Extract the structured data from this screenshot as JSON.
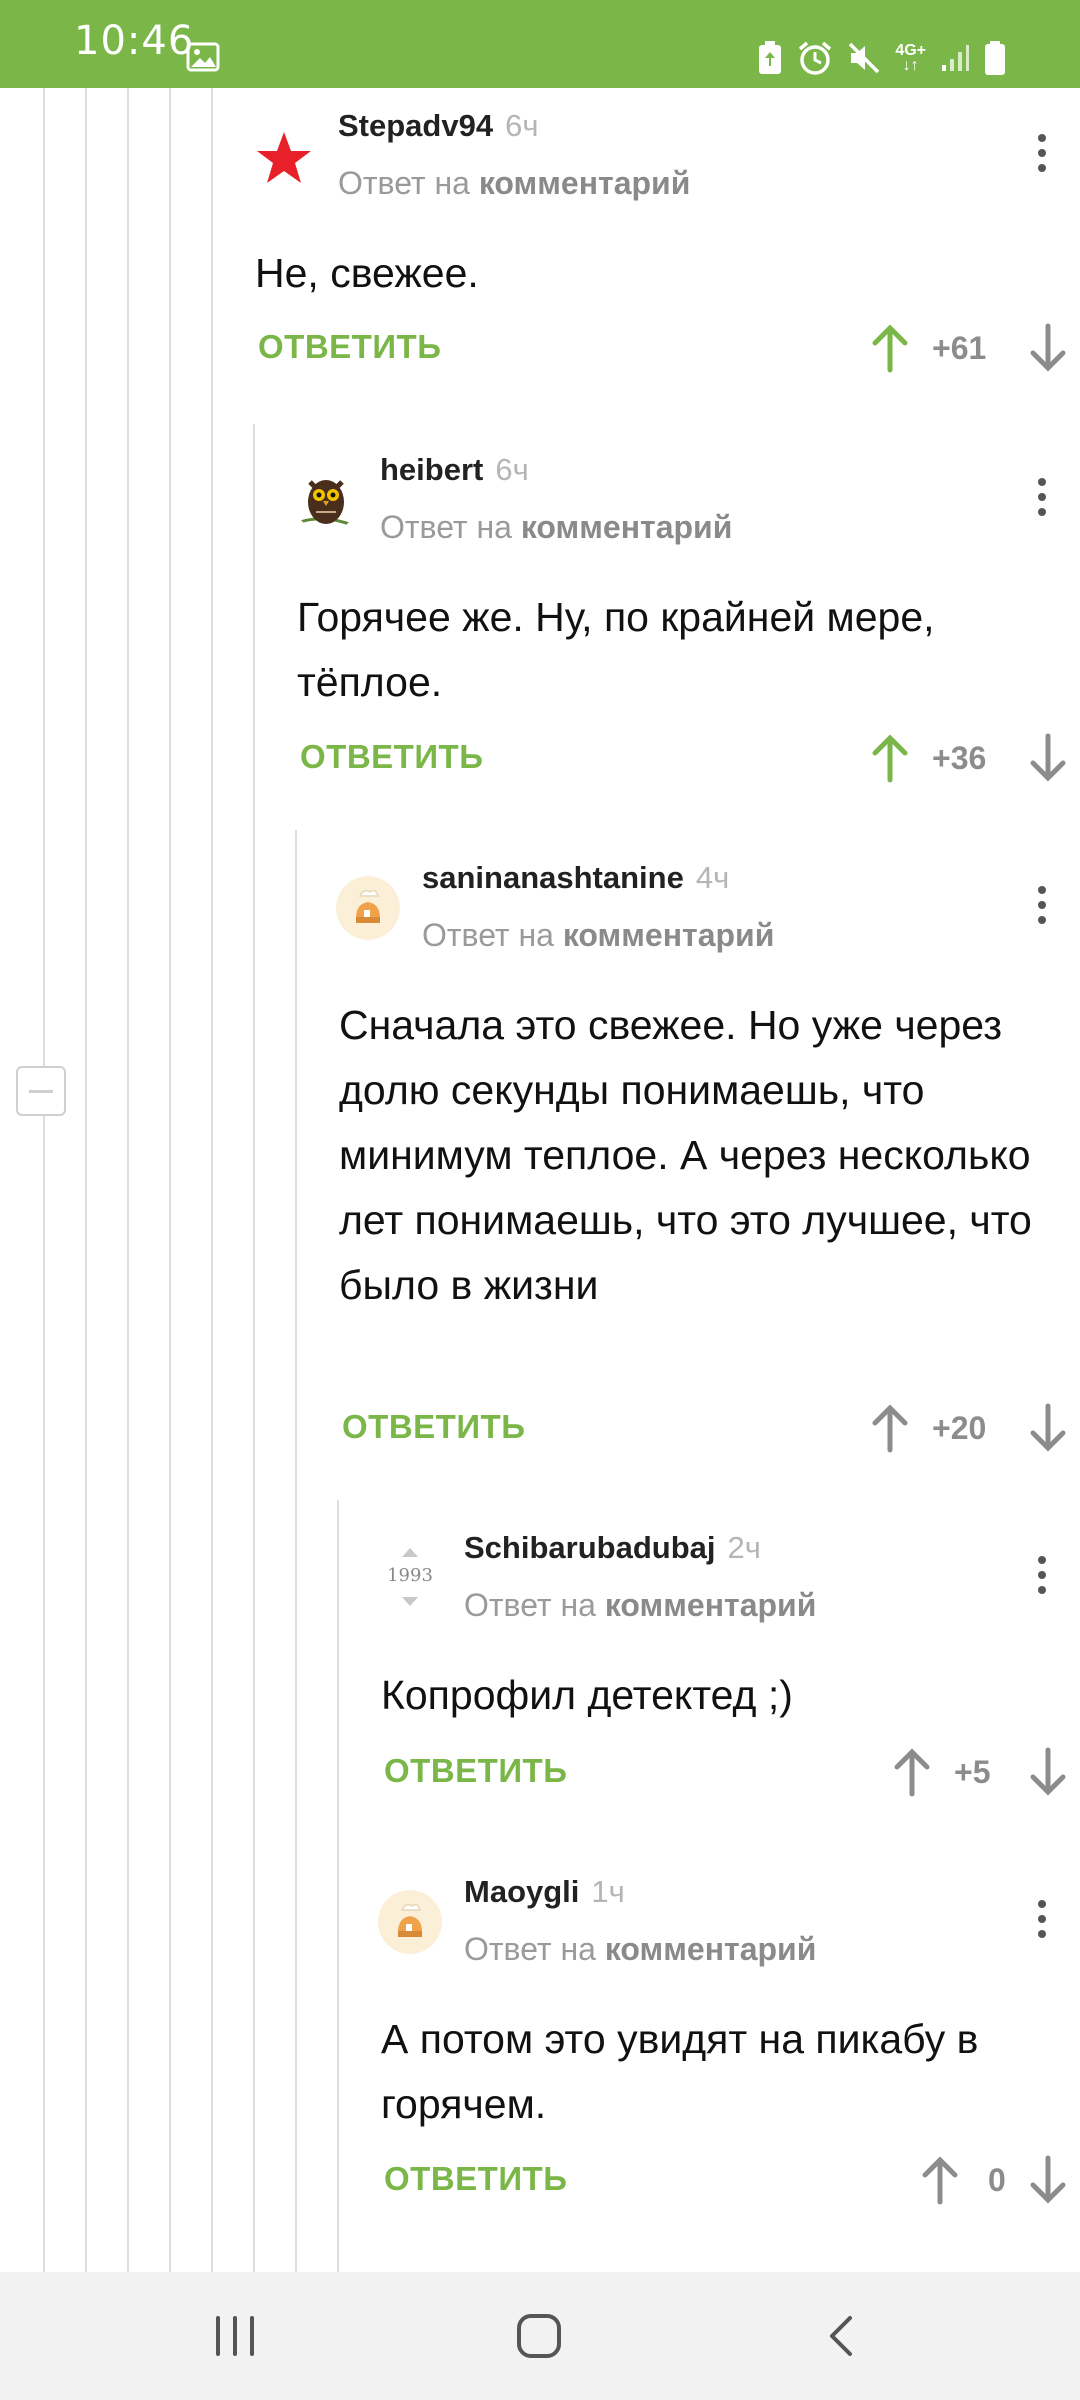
{
  "status_bar": {
    "time": "10:46",
    "network_label": "4G+",
    "icons": [
      "gallery-icon",
      "battery-saver-icon",
      "alarm-icon",
      "mute-icon",
      "signal-icon",
      "battery-icon"
    ]
  },
  "colors": {
    "accent": "#7ab648",
    "upvote_active": "#7ab648",
    "vote_inactive": "#8c8c8c"
  },
  "reply_prefix": "Ответ на",
  "reply_target": "комментарий",
  "reply_label": "ОТВЕТИТЬ",
  "comments": [
    {
      "author": "Stepadv94",
      "time": "6ч",
      "text": "Не, свежее.",
      "score": "+61",
      "upvoted": true,
      "avatar": "red-star-avatar"
    },
    {
      "author": "heibert",
      "time": "6ч",
      "text": "Горячее же. Ну, по крайней мере, тёплое.",
      "score": "+36",
      "upvoted": true,
      "avatar": "owl-avatar"
    },
    {
      "author": "saninanashtanine",
      "time": "4ч",
      "text": "Сначала это свежее. Но уже через долю секунды понимаешь, что минимум теплое. А через несколько лет понимаешь, что это лучшее, что было в жизни",
      "score": "+20",
      "upvoted": false,
      "avatar": "default-pikabu-avatar"
    },
    {
      "author": "Schibarubadubaj",
      "time": "2ч",
      "text": "Копрофил детектед ;)",
      "score": "+5",
      "upvoted": false,
      "avatar": "year-1993-avatar",
      "avatar_text": "1993"
    },
    {
      "author": "Maoygli",
      "time": "1ч",
      "text": "А потом это увидят на пикабу в горячем.",
      "score": "0",
      "upvoted": false,
      "avatar": "default-pikabu-avatar"
    }
  ]
}
